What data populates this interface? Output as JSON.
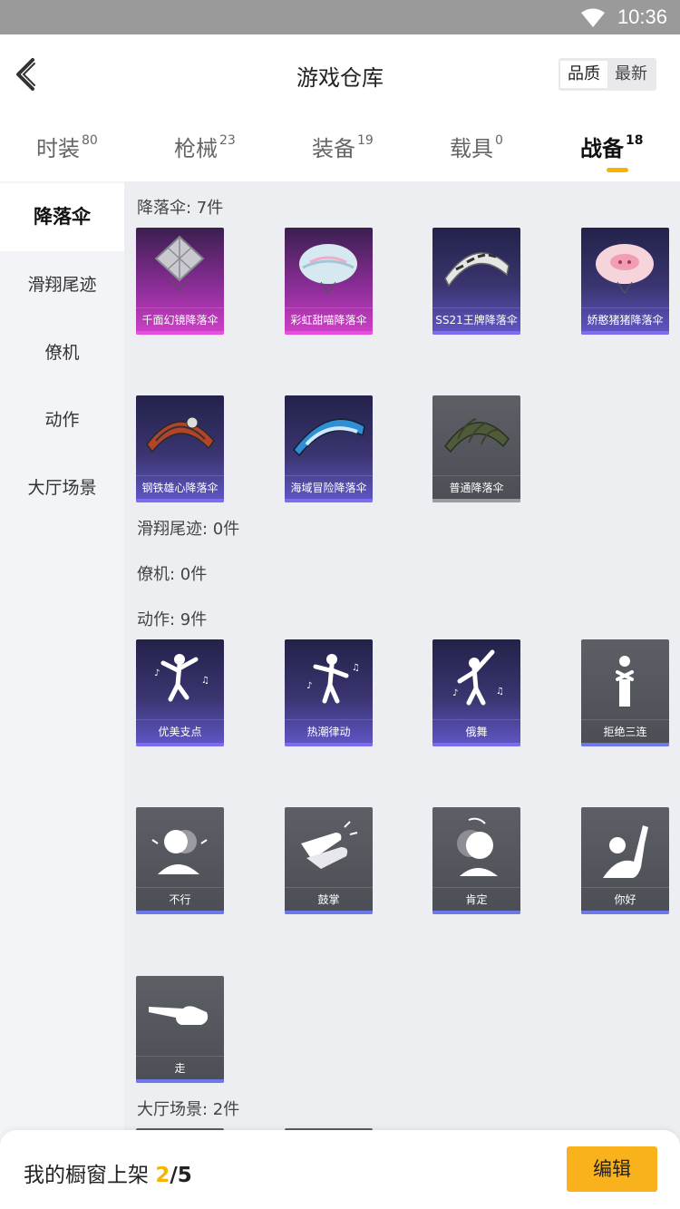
{
  "status_bar": {
    "time": "10:36"
  },
  "header": {
    "title": "游戏仓库",
    "sort": [
      "品质",
      "最新"
    ]
  },
  "tabs": [
    {
      "label": "时装",
      "count": "80"
    },
    {
      "label": "枪械",
      "count": "23"
    },
    {
      "label": "装备",
      "count": "19"
    },
    {
      "label": "载具",
      "count": "0"
    },
    {
      "label": "战备",
      "count": "18"
    }
  ],
  "sidebar": {
    "items": [
      "降落伞",
      "滑翔尾迹",
      "僚机",
      "动作",
      "大厅场景"
    ]
  },
  "sections": {
    "parachute": {
      "title": "降落伞: 7件",
      "items": [
        "千面幻镜降落伞",
        "彩虹甜喵降落伞",
        "SS21王牌降落伞",
        "娇憨猪猪降落伞",
        "钢铁雄心降落伞",
        "海域冒险降落伞",
        "普通降落伞"
      ]
    },
    "trail": {
      "title": "滑翔尾迹: 0件"
    },
    "wingman": {
      "title": "僚机: 0件"
    },
    "emote": {
      "title": "动作: 9件",
      "items": [
        "优美支点",
        "热潮律动",
        "俄舞",
        "拒绝三连",
        "不行",
        "鼓掌",
        "肯定",
        "你好",
        "走"
      ]
    },
    "lobby": {
      "title": "大厅场景: 2件"
    }
  },
  "bottom_bar": {
    "label": "我的橱窗上架 ",
    "current": "2",
    "total": "/5",
    "edit_label": "编辑"
  },
  "colors": {
    "accent": "#f5b400",
    "edit_button": "#f9b21b"
  }
}
